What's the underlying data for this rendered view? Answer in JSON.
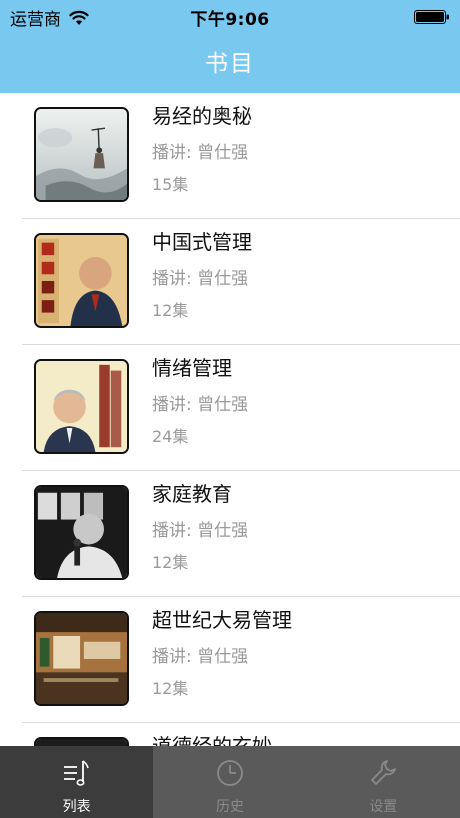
{
  "status_bar": {
    "carrier": "运营商",
    "time": "下午9:06"
  },
  "nav": {
    "title": "书目"
  },
  "books": [
    {
      "title": "易经的奥秘",
      "lecturer": "播讲:  曾仕强",
      "episodes": "15集",
      "cover_icon": "ink-painting-cover"
    },
    {
      "title": "中国式管理",
      "lecturer": "播讲:  曾仕强",
      "episodes": "12集",
      "cover_icon": "book-cover-zhongguoshi-guanli"
    },
    {
      "title": "情绪管理",
      "lecturer": "播讲:  曾仕强",
      "episodes": "24集",
      "cover_icon": "book-cover-qingxu-guanli"
    },
    {
      "title": "家庭教育",
      "lecturer": "播讲:  曾仕强",
      "episodes": "12集",
      "cover_icon": "bw-portrait-cover"
    },
    {
      "title": "超世纪大易管理",
      "lecturer": "播讲:  曾仕强",
      "episodes": "12集",
      "cover_icon": "book-cover-dayi-guanli"
    },
    {
      "title": "道德经的玄妙",
      "lecturer": "",
      "episodes": "",
      "cover_icon": "dark-cover"
    }
  ],
  "tabbar": {
    "tabs": [
      {
        "label": "列表",
        "icon": "music-list-icon",
        "active": true
      },
      {
        "label": "历史",
        "icon": "clock-icon",
        "active": false
      },
      {
        "label": "设置",
        "icon": "wrench-icon",
        "active": false
      }
    ]
  },
  "colors": {
    "nav_background": "#78c8f0",
    "tabbar_background": "#5a5a5a",
    "tab_active_background": "#3c3c3c"
  }
}
